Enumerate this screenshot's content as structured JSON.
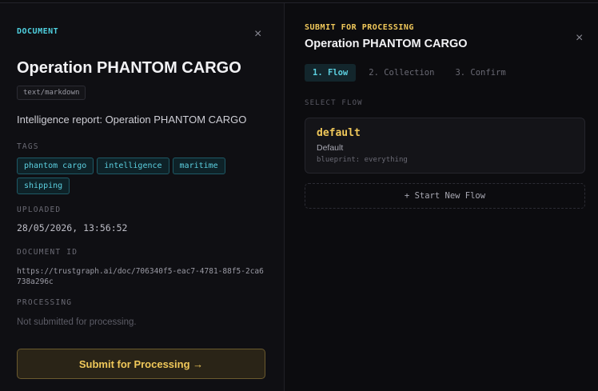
{
  "document_panel": {
    "eyebrow": "DOCUMENT",
    "close_glyph": "×",
    "title": "Operation PHANTOM CARGO",
    "mime_type": "text/markdown",
    "description": "Intelligence report: Operation PHANTOM CARGO",
    "tags_label": "TAGS",
    "tags": [
      "phantom cargo",
      "intelligence",
      "maritime",
      "shipping"
    ],
    "uploaded_label": "UPLOADED",
    "uploaded_value": "28/05/2026, 13:56:52",
    "doc_id_label": "DOCUMENT ID",
    "doc_id_value": "https://trustgraph.ai/doc/706340f5-eac7-4781-88f5-2ca6738a296c",
    "processing_label": "PROCESSING",
    "processing_value": "Not submitted for processing.",
    "submit_button": "Submit for Processing →"
  },
  "processing_panel": {
    "eyebrow": "SUBMIT FOR PROCESSING",
    "title": "Operation PHANTOM CARGO",
    "close_glyph": "×",
    "steps": [
      {
        "label": "1. Flow",
        "active": true
      },
      {
        "label": "2. Collection",
        "active": false
      },
      {
        "label": "3. Confirm",
        "active": false
      }
    ],
    "select_label": "SELECT FLOW",
    "flows": [
      {
        "name": "default",
        "description": "Default",
        "blueprint": "blueprint: everything"
      }
    ],
    "new_flow_button": "+ Start New Flow"
  },
  "colors": {
    "accent_cyan": "#4fd1e0",
    "accent_gold": "#f0c85a",
    "background": "#0d0d10"
  }
}
